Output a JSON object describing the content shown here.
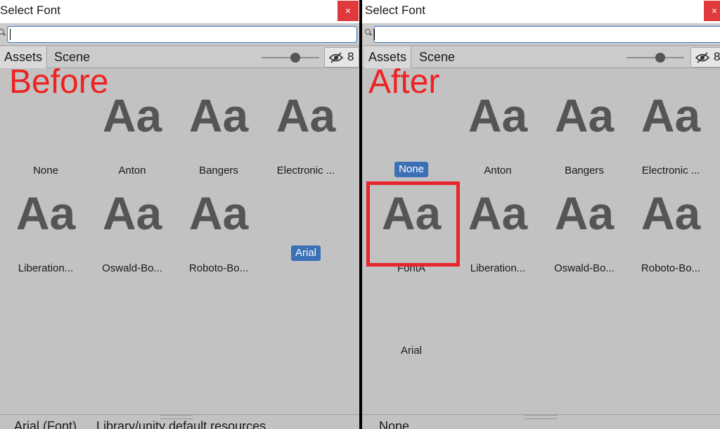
{
  "left_panel": {
    "title": "Select Font",
    "close_icon": "×",
    "search_value": "",
    "tabs": [
      "Assets",
      "Scene"
    ],
    "hidden_count": "8",
    "overlay_label": "Before",
    "glyph": "Aa",
    "items": [
      {
        "label": "None",
        "has_glyph": false,
        "selected": false
      },
      {
        "label": "Anton",
        "has_glyph": true,
        "selected": false
      },
      {
        "label": "Bangers",
        "has_glyph": true,
        "selected": false
      },
      {
        "label": "Electronic ...",
        "has_glyph": true,
        "selected": false
      },
      {
        "label": "Liberation...",
        "has_glyph": true,
        "selected": false
      },
      {
        "label": "Oswald-Bo...",
        "has_glyph": true,
        "selected": false
      },
      {
        "label": "Roboto-Bo...",
        "has_glyph": true,
        "selected": false
      },
      {
        "label": "Arial",
        "has_glyph": false,
        "selected": true
      }
    ],
    "status": {
      "name": "Arial (Font)",
      "path": "Library/unity default resources"
    }
  },
  "right_panel": {
    "title": "Select Font",
    "close_icon": "×",
    "search_value": "",
    "tabs": [
      "Assets",
      "Scene"
    ],
    "hidden_count": "8",
    "overlay_label": "After",
    "glyph": "Aa",
    "items": [
      {
        "label": "None",
        "has_glyph": false,
        "selected": true
      },
      {
        "label": "Anton",
        "has_glyph": true,
        "selected": false
      },
      {
        "label": "Bangers",
        "has_glyph": true,
        "selected": false
      },
      {
        "label": "Electronic ...",
        "has_glyph": true,
        "selected": false
      },
      {
        "label": "FontA",
        "has_glyph": true,
        "selected": false,
        "highlighted": true
      },
      {
        "label": "Liberation...",
        "has_glyph": true,
        "selected": false
      },
      {
        "label": "Oswald-Bo...",
        "has_glyph": true,
        "selected": false
      },
      {
        "label": "Roboto-Bo...",
        "has_glyph": true,
        "selected": false
      },
      {
        "label": "Arial",
        "has_glyph": false,
        "selected": false
      }
    ],
    "status": {
      "name": "None",
      "path": ""
    }
  },
  "icons": {
    "search": "search-icon",
    "close": "close-icon",
    "visibility": "eye-slash-icon"
  },
  "colors": {
    "accent": "#3b6fb6",
    "close": "#e0393b",
    "annotation": "#ee2222",
    "glyph": "#555555",
    "background": "#c2c2c2"
  }
}
